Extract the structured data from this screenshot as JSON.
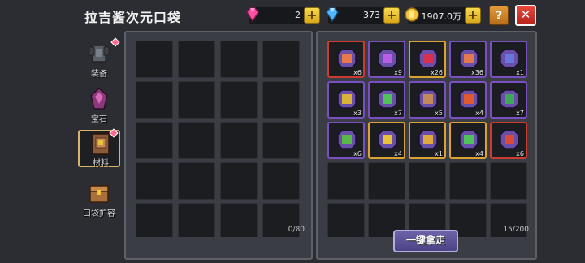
{
  "header": {
    "title": "拉吉酱次元口袋",
    "currencies": [
      {
        "icon": "pink-gem-icon",
        "value": "2",
        "color": "#ff4fa0"
      },
      {
        "icon": "blue-gem-icon",
        "value": "373",
        "color": "#4fb8ff"
      },
      {
        "icon": "gold-coin-icon",
        "value": "1907.0万",
        "color": "#f5c33b"
      }
    ],
    "plus_label": "+",
    "help_label": "?",
    "close_label": "✕"
  },
  "tabs": [
    {
      "label": "装备",
      "icon": "armor-icon",
      "active": false,
      "badge": true
    },
    {
      "label": "宝石",
      "icon": "gem-icon",
      "active": false,
      "badge": false
    },
    {
      "label": "材料",
      "icon": "material-book-icon",
      "active": true,
      "badge": true
    },
    {
      "label": "口袋扩容",
      "icon": "treasure-chest-icon",
      "active": false,
      "badge": false
    }
  ],
  "left_panel": {
    "count": "0/80"
  },
  "right_panel": {
    "count": "15/200",
    "take_all_label": "一键拿走",
    "items": [
      {
        "name": "crystal-ore",
        "qty": "x6",
        "rarity": "red",
        "color": "#e8774a"
      },
      {
        "name": "purple-rune",
        "qty": "x9",
        "rarity": "purple",
        "color": "#b85ee6"
      },
      {
        "name": "red-crystal",
        "qty": "x26",
        "rarity": "gold",
        "color": "#d9304f"
      },
      {
        "name": "copper-shard",
        "qty": "x36",
        "rarity": "purple",
        "color": "#e07a4c"
      },
      {
        "name": "blue-chest",
        "qty": "x1",
        "rarity": "purple",
        "color": "#6677e0"
      },
      {
        "name": "golden-cone",
        "qty": "x3",
        "rarity": "purple",
        "color": "#d9b23a"
      },
      {
        "name": "green-slime",
        "qty": "x7",
        "rarity": "purple",
        "color": "#4fc25a"
      },
      {
        "name": "bird-feather",
        "qty": "x5",
        "rarity": "purple",
        "color": "#c28a5a"
      },
      {
        "name": "fire-orb",
        "qty": "x4",
        "rarity": "purple",
        "color": "#e05a30"
      },
      {
        "name": "green-bar",
        "qty": "x7",
        "rarity": "purple",
        "color": "#3fa85a"
      },
      {
        "name": "cactus",
        "qty": "x6",
        "rarity": "purple",
        "color": "#5ab84a"
      },
      {
        "name": "golden-bell",
        "qty": "x4",
        "rarity": "gold",
        "color": "#e8c23a"
      },
      {
        "name": "pickaxe",
        "qty": "x1",
        "rarity": "gold",
        "color": "#e0a840"
      },
      {
        "name": "green-dragon",
        "qty": "x4",
        "rarity": "gold",
        "color": "#4fc25a"
      },
      {
        "name": "red-herb",
        "qty": "x6",
        "rarity": "red",
        "color": "#d94a3a"
      }
    ]
  }
}
